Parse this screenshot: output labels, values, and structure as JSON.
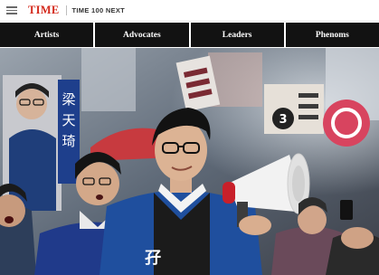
{
  "header": {
    "logo_text": "TIME",
    "subbrand_text": "TIME 100 NEXT",
    "logo_color": "#d42b1e"
  },
  "nav": {
    "tabs": [
      {
        "label": "Artists"
      },
      {
        "label": "Advocates"
      },
      {
        "label": "Leaders"
      },
      {
        "label": "Phenoms"
      }
    ]
  },
  "hero": {
    "description_icon": "photo",
    "sign_text_left": "梁天琦",
    "sign_text_number": "3",
    "colors": {
      "jacket": "#1f4f9e",
      "megaphone_body": "#f2f2f2",
      "megaphone_accent": "#c8202a"
    }
  }
}
